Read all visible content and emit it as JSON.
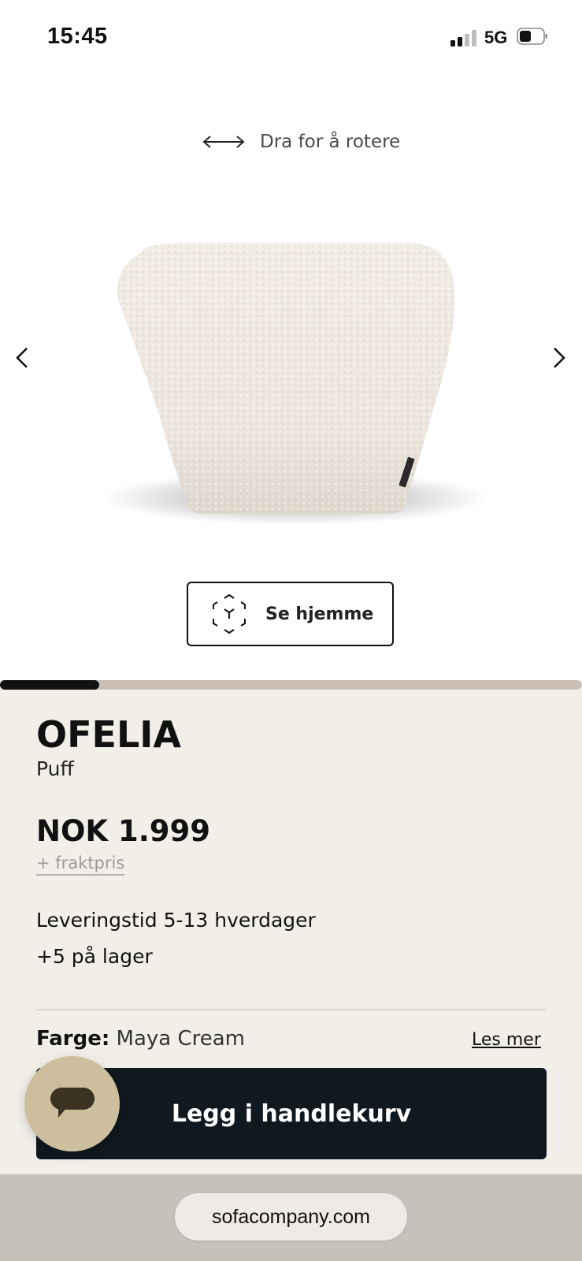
{
  "status_bar": {
    "time": "15:45",
    "network": "5G"
  },
  "viewer": {
    "rotate_hint": "Dra for å rotere",
    "ar_button_label": "Se hjemme",
    "gallery_progress": 0.17
  },
  "product": {
    "name": "OFELIA",
    "type": "Puff",
    "price": "NOK 1.999",
    "shipping_link": "+ fraktpris",
    "delivery_time": "Leveringstid 5-13 hverdager",
    "stock": "+5 på lager",
    "color_label": "Farge:",
    "color_value": "Maya Cream",
    "read_more": "Les mer",
    "add_to_cart": "Legg i handlekurv"
  },
  "browser": {
    "url": "sofacompany.com"
  },
  "colors": {
    "panel_background": "#f2efe9",
    "cart_button": "#101820",
    "chat_button": "#cdbf9d",
    "product_fabric": "#ece6dd"
  },
  "icons": [
    "signal-icon",
    "battery-icon",
    "rotate-arrows-icon",
    "chevron-left-icon",
    "chevron-right-icon",
    "ar-cube-icon",
    "chat-icon"
  ]
}
